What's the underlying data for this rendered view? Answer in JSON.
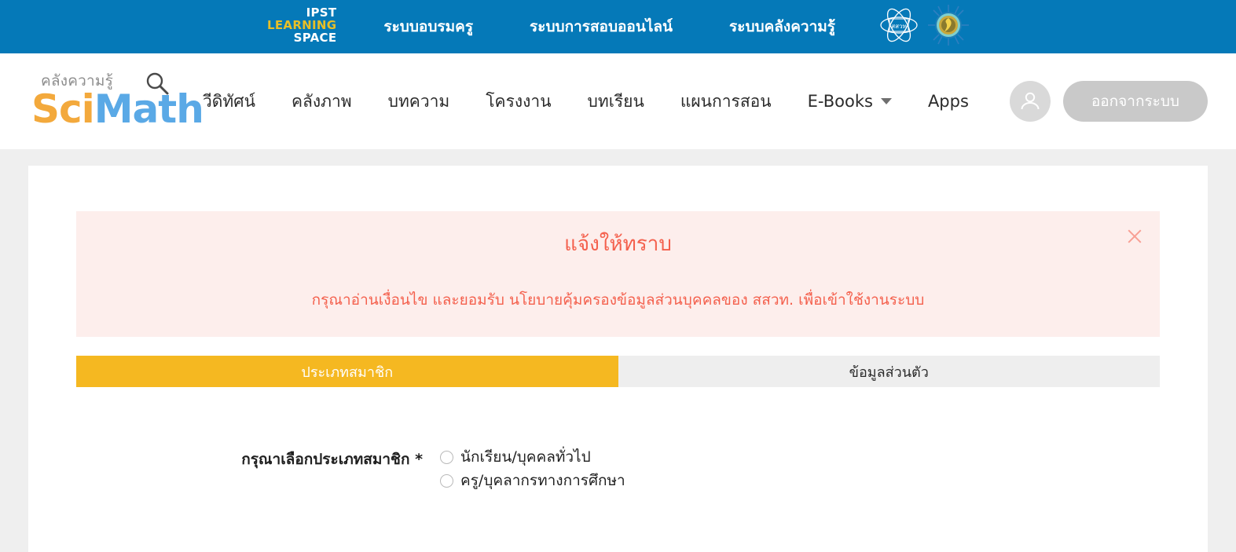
{
  "topbar": {
    "brand_logo": {
      "line1": "IPST",
      "line2": "LEARNING",
      "line3": "SPACE"
    },
    "links": [
      {
        "label": "ระบบอบรมครู",
        "name": "topnav-teacher-training"
      },
      {
        "label": "ระบบการสอบออนไลน์",
        "name": "topnav-online-exam"
      },
      {
        "label": "ระบบคลังความรู้",
        "name": "topnav-knowledge-bank"
      }
    ],
    "logos": [
      {
        "name": "ipst-atom-logo",
        "inner_text": "สสวท"
      },
      {
        "name": "ministry-seal-logo"
      }
    ],
    "bg_color": "#0579b8",
    "accent_color": "#e8bf27"
  },
  "header": {
    "brand": {
      "tagline": "คลังความรู้",
      "name_sci": "Sci",
      "name_math": "Math",
      "sci_color": "#f3a93c",
      "math_color": "#5aa9e6",
      "search_icon": "magnifier-icon"
    },
    "nav": [
      {
        "label": "วีดิทัศน์",
        "name": "nav-item-video",
        "caret": false
      },
      {
        "label": "คลังภาพ",
        "name": "nav-item-image-bank",
        "caret": false
      },
      {
        "label": "บทความ",
        "name": "nav-item-article",
        "caret": false
      },
      {
        "label": "โครงงาน",
        "name": "nav-item-project",
        "caret": false
      },
      {
        "label": "บทเรียน",
        "name": "nav-item-lesson",
        "caret": false
      },
      {
        "label": "แผนการสอน",
        "name": "nav-item-lesson-plan",
        "caret": false
      },
      {
        "label": "E-Books",
        "name": "nav-item-ebooks",
        "caret": true
      },
      {
        "label": "Apps",
        "name": "nav-item-apps",
        "caret": false
      }
    ],
    "account_icon": "user-avatar-icon",
    "logout_label": "ออกจากระบบ",
    "logout_color": "#c9c9c9"
  },
  "alert": {
    "title": "แจ้งให้ทราบ",
    "message": "กรุณาอ่านเงื่อนไข และยอมรับ นโยบายคุ้มครองข้อมูลส่วนบุคคลของ สสวท. เพื่อเข้าใช้งานระบบ",
    "close_icon": "close-x-icon",
    "bg_color": "#fdeeec",
    "text_color": "#f4604d"
  },
  "tabs": [
    {
      "label": "ประเภทสมาชิก",
      "name": "tab-member-type",
      "active": true
    },
    {
      "label": "ข้อมูลส่วนตัว",
      "name": "tab-personal-info",
      "active": false
    }
  ],
  "form": {
    "member_type_label": "กรุณาเลือกประเภทสมาชิก *",
    "options": [
      {
        "label": "นักเรียน/บุคคลทั่วไป",
        "name": "radio-student-general",
        "selected": false
      },
      {
        "label": "ครู/บุคลากรทางการศึกษา",
        "name": "radio-teacher-staff",
        "selected": false
      }
    ]
  },
  "theme": {
    "page_bg": "#efefef",
    "card_bg": "#ffffff",
    "tab_active": "#f5b821",
    "tab_inactive": "#eeeeee"
  }
}
